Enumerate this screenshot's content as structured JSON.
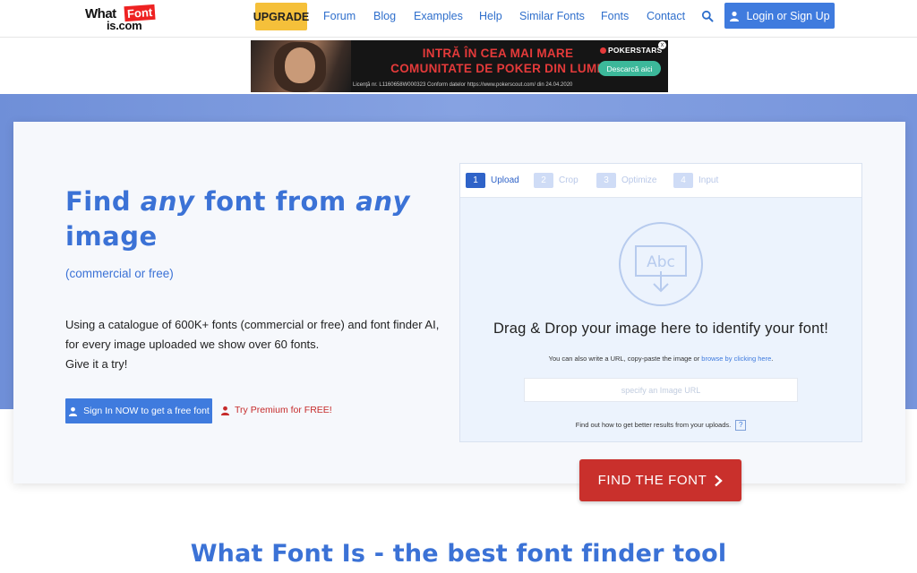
{
  "header": {
    "logo": {
      "part1": "What",
      "part2": "Font",
      "part3": "is.com"
    },
    "upgrade_label": "UPGRADE",
    "nav": [
      "Forum",
      "Blog",
      "Examples",
      "Help",
      "Similar Fonts",
      "Fonts",
      "Contact"
    ],
    "search_icon": "search-icon",
    "login_label": "Login or Sign Up"
  },
  "ad": {
    "headline_line1": "INTRĂ ÎN CEA MAI MARE",
    "headline_line2": "COMUNITATE DE POKER DIN LUME",
    "brand": "POKERSTARS",
    "cta": "Descarcă aici",
    "legal": "Licenţă nr. L1160658W000323   Conform datelor https://www.pokerscout.com/ din 24.04.2020",
    "close": "x"
  },
  "hero": {
    "title_pre": "Find ",
    "title_em1": "any",
    "title_mid": " font from ",
    "title_em2": "any",
    "title_post": " image",
    "subtitle": "(commercial or free)",
    "desc_line1": "Using a catalogue of 600K+ fonts (commercial or free) and font finder AI,",
    "desc_line2": "for every image uploaded we show over 60 fonts.",
    "desc_line3": "Give it a try!",
    "signin_label": "Sign In NOW to get a free font",
    "premium_label": "Try Premium for FREE!"
  },
  "uploader": {
    "steps": [
      {
        "num": "1",
        "label": "Upload"
      },
      {
        "num": "2",
        "label": "Crop"
      },
      {
        "num": "3",
        "label": "Optimize"
      },
      {
        "num": "4",
        "label": "Input"
      }
    ],
    "icon_text": "Abc",
    "drop_title": "Drag & Drop your image here to identify your font!",
    "hint_pre": "You can also write a URL, copy-paste the image or ",
    "hint_link": "browse by clicking here",
    "hint_post": ".",
    "url_placeholder": "specify an Image URL",
    "better_results": "Find out how to get better results from your uploads.",
    "help_label": "?"
  },
  "find_button": "FIND THE FONT",
  "bottom_title": "What Font Is - the best font finder tool",
  "colors": {
    "brand_blue": "#3b72d6",
    "button_blue": "#3f7bde",
    "upgrade_yellow": "#f5c03a",
    "find_red": "#c9302c",
    "premium_red": "#c62b2b"
  }
}
